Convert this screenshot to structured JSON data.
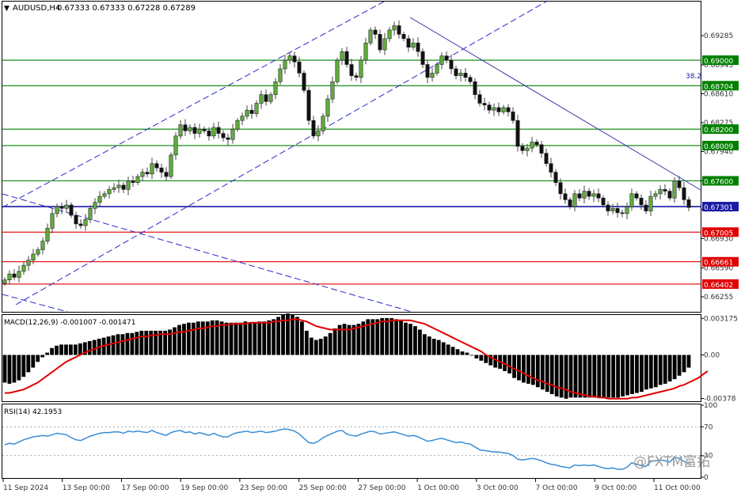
{
  "header": {
    "symbol_label": "AUDUSD,H4",
    "ohlc_label": "0.67333 0.67333 0.67228 0.67289"
  },
  "watermark": {
    "text": "@FXTM富拓"
  },
  "fib_label": "38.2",
  "chart_data": [
    {
      "type": "candlestick",
      "symbol": "AUDUSD",
      "timeframe": "H4",
      "last_bar": {
        "open": 0.67333,
        "high": 0.67333,
        "low": 0.67228,
        "close": 0.67289
      },
      "ylim": [
        0.6608,
        0.6968
      ],
      "price_ticks": [
        0.69285,
        0.68945,
        0.6861,
        0.68275,
        0.6794,
        0.676,
        0.6727,
        0.6693,
        0.6659,
        0.66255
      ],
      "price_tick_labels": [
        "0.69285",
        "0.68945",
        "0.68610",
        "0.68275",
        "0.67940",
        "0.67600",
        "0.67270",
        "0.66930",
        "0.66590",
        "0.66255"
      ],
      "x_labels": [
        "11 Sep 2024",
        "13 Sep 00:00",
        "17 Sep 00:00",
        "19 Sep 00:00",
        "23 Sep 00:00",
        "25 Sep 00:00",
        "27 Sep 00:00",
        "1 Oct 00:00",
        "3 Oct 00:00",
        "7 Oct 00:00",
        "9 Oct 00:00",
        "11 Oct 00:00"
      ],
      "horizontal_levels": [
        {
          "value": 0.69,
          "label": "0.69000",
          "color": "#008000"
        },
        {
          "value": 0.68704,
          "label": "0.68704",
          "color": "#008000"
        },
        {
          "value": 0.682,
          "label": "0.68200",
          "color": "#008000"
        },
        {
          "value": 0.68009,
          "label": "0.68009",
          "color": "#008000"
        },
        {
          "value": 0.676,
          "label": "0.67600",
          "color": "#008000"
        },
        {
          "value": 0.67301,
          "label": "0.67301",
          "color": "#1a1aa6"
        },
        {
          "value": 0.67005,
          "label": "0.67005",
          "color": "#e00000"
        },
        {
          "value": 0.66661,
          "label": "0.66661",
          "color": "#e00000"
        },
        {
          "value": 0.66402,
          "label": "0.66402",
          "color": "#e00000"
        }
      ],
      "close_series": [
        0.6645,
        0.6652,
        0.6648,
        0.6655,
        0.6662,
        0.6668,
        0.6675,
        0.668,
        0.669,
        0.6705,
        0.6722,
        0.673,
        0.6728,
        0.6732,
        0.672,
        0.671,
        0.6708,
        0.6715,
        0.6728,
        0.6735,
        0.6742,
        0.6745,
        0.675,
        0.6752,
        0.6755,
        0.675,
        0.676,
        0.6758,
        0.6765,
        0.677,
        0.6768,
        0.678,
        0.6775,
        0.677,
        0.6765,
        0.679,
        0.6812,
        0.6825,
        0.6818,
        0.6822,
        0.6815,
        0.682,
        0.6818,
        0.6812,
        0.6822,
        0.6815,
        0.681,
        0.6808,
        0.682,
        0.683,
        0.6835,
        0.6842,
        0.6838,
        0.685,
        0.686,
        0.6852,
        0.686,
        0.6875,
        0.689,
        0.69,
        0.6905,
        0.6898,
        0.6885,
        0.6865,
        0.683,
        0.6812,
        0.6818,
        0.6835,
        0.6855,
        0.6875,
        0.69,
        0.691,
        0.6895,
        0.6882,
        0.688,
        0.69,
        0.692,
        0.6935,
        0.693,
        0.6912,
        0.6925,
        0.6935,
        0.694,
        0.693,
        0.6925,
        0.6915,
        0.692,
        0.691,
        0.6895,
        0.688,
        0.6885,
        0.6895,
        0.6905,
        0.69,
        0.689,
        0.6882,
        0.6885,
        0.688,
        0.6875,
        0.686,
        0.685,
        0.6848,
        0.6842,
        0.6845,
        0.684,
        0.6845,
        0.684,
        0.683,
        0.68,
        0.6795,
        0.6798,
        0.6805,
        0.6802,
        0.6792,
        0.678,
        0.677,
        0.6758,
        0.6745,
        0.6738,
        0.673,
        0.6745,
        0.674,
        0.6748,
        0.6742,
        0.6745,
        0.674,
        0.6732,
        0.6725,
        0.6728,
        0.6723,
        0.6722,
        0.673,
        0.6745,
        0.674,
        0.6732,
        0.6725,
        0.6742,
        0.6745,
        0.675,
        0.6748,
        0.674,
        0.676,
        0.6752,
        0.6738,
        0.6729
      ]
    },
    {
      "type": "histogram",
      "indicator": "MACD",
      "label": "MACD(12,26,9) -0.001007 -0.001471",
      "params": [
        12,
        26,
        9
      ],
      "macd": -0.001007,
      "signal": -0.001471,
      "ylim": [
        -0.00395,
        0.0034
      ],
      "ticks": [
        0.003175,
        0.0,
        -0.00378
      ],
      "tick_labels": [
        "0.003175",
        "0.00",
        "-0.00378"
      ],
      "histogram": [
        -0.0024,
        -0.0025,
        -0.0024,
        -0.0022,
        -0.0019,
        -0.0015,
        -0.0011,
        -0.0006,
        -0.0002,
        0.0002,
        0.0006,
        0.0008,
        0.0009,
        0.0009,
        0.0009,
        0.0009,
        0.001,
        0.0011,
        0.0012,
        0.0013,
        0.0014,
        0.0015,
        0.0016,
        0.0017,
        0.0018,
        0.0018,
        0.0019,
        0.0019,
        0.002,
        0.0021,
        0.0021,
        0.0021,
        0.0021,
        0.0021,
        0.0021,
        0.0022,
        0.0024,
        0.0026,
        0.0027,
        0.0028,
        0.0028,
        0.0029,
        0.0029,
        0.0029,
        0.003,
        0.003,
        0.0029,
        0.0028,
        0.0028,
        0.0028,
        0.0028,
        0.0029,
        0.0028,
        0.0028,
        0.0029,
        0.0029,
        0.003,
        0.0031,
        0.0033,
        0.0035,
        0.0036,
        0.0035,
        0.0033,
        0.0029,
        0.0021,
        0.0015,
        0.0013,
        0.0014,
        0.0016,
        0.0019,
        0.0023,
        0.0026,
        0.0027,
        0.0026,
        0.0026,
        0.0027,
        0.0029,
        0.0031,
        0.0031,
        0.0031,
        0.0032,
        0.0032,
        0.0032,
        0.0031,
        0.003,
        0.0028,
        0.0027,
        0.0025,
        0.0022,
        0.0018,
        0.0016,
        0.0014,
        0.0013,
        0.0011,
        0.0009,
        0.0007,
        0.0005,
        0.0003,
        0.0002,
        0.0,
        -0.0003,
        -0.0005,
        -0.0007,
        -0.0009,
        -0.0011,
        -0.0012,
        -0.0014,
        -0.0016,
        -0.002,
        -0.0022,
        -0.0024,
        -0.0025,
        -0.0026,
        -0.0028,
        -0.003,
        -0.0032,
        -0.0034,
        -0.0036,
        -0.0037,
        -0.0038,
        -0.0037,
        -0.0037,
        -0.0037,
        -0.0037,
        -0.0037,
        -0.0037,
        -0.0037,
        -0.0037,
        -0.0037,
        -0.0037,
        -0.0037,
        -0.0036,
        -0.0035,
        -0.0034,
        -0.0033,
        -0.0032,
        -0.003,
        -0.0029,
        -0.0028,
        -0.0026,
        -0.0025,
        -0.0023,
        -0.0021,
        -0.0018,
        -0.0015,
        -0.0011
      ],
      "signal_line": [
        -0.0033,
        -0.0033,
        -0.0032,
        -0.0031,
        -0.003,
        -0.0028,
        -0.0026,
        -0.0024,
        -0.0021,
        -0.0018,
        -0.0015,
        -0.0012,
        -0.0009,
        -0.0006,
        -0.0004,
        -0.0002,
        0.0,
        0.0002,
        0.0004,
        0.0005,
        0.0007,
        0.0008,
        0.0009,
        0.001,
        0.0011,
        0.0012,
        0.0013,
        0.0014,
        0.0015,
        0.0016,
        0.0016,
        0.0017,
        0.0017,
        0.0018,
        0.0018,
        0.0018,
        0.0019,
        0.002,
        0.002,
        0.0021,
        0.0022,
        0.0023,
        0.0023,
        0.0024,
        0.0025,
        0.0025,
        0.0026,
        0.0026,
        0.0027,
        0.0027,
        0.0027,
        0.0027,
        0.0028,
        0.0028,
        0.0028,
        0.0028,
        0.0028,
        0.0029,
        0.0029,
        0.003,
        0.003,
        0.0031,
        0.0031,
        0.003,
        0.0029,
        0.0027,
        0.0025,
        0.0024,
        0.0023,
        0.0022,
        0.0022,
        0.0022,
        0.0022,
        0.0022,
        0.0023,
        0.0024,
        0.0025,
        0.0026,
        0.0027,
        0.0028,
        0.0029,
        0.0029,
        0.003,
        0.003,
        0.003,
        0.003,
        0.003,
        0.0029,
        0.0028,
        0.0027,
        0.0025,
        0.0023,
        0.0021,
        0.0019,
        0.0017,
        0.0015,
        0.0013,
        0.0011,
        0.0009,
        0.0007,
        0.0005,
        0.0003,
        0.0,
        -0.0002,
        -0.0004,
        -0.0006,
        -0.0008,
        -0.001,
        -0.0012,
        -0.0014,
        -0.0016,
        -0.0018,
        -0.002,
        -0.0022,
        -0.0023,
        -0.0025,
        -0.0026,
        -0.0028,
        -0.0029,
        -0.003,
        -0.0032,
        -0.0033,
        -0.0034,
        -0.0035,
        -0.0036,
        -0.0036,
        -0.0037,
        -0.0037,
        -0.0038,
        -0.0038,
        -0.0038,
        -0.0038,
        -0.0038,
        -0.0037,
        -0.0037,
        -0.0036,
        -0.0035,
        -0.0034,
        -0.0033,
        -0.0032,
        -0.0031,
        -0.003,
        -0.0029,
        -0.0027,
        -0.0026,
        -0.0024,
        -0.0022,
        -0.002,
        -0.0017,
        -0.0014
      ]
    },
    {
      "type": "line",
      "indicator": "RSI",
      "label": "RSI(14) 42.1953",
      "period": 14,
      "value": 42.1953,
      "ylim": [
        0,
        100
      ],
      "ticks": [
        100,
        70,
        30,
        0
      ],
      "tick_labels": [
        "100",
        "70",
        "30",
        "0"
      ],
      "values": [
        45,
        47,
        46,
        49,
        52,
        54,
        56,
        57,
        58,
        57,
        59,
        61,
        60,
        59,
        55,
        52,
        51,
        54,
        57,
        59,
        61,
        62,
        62,
        63,
        63,
        61,
        64,
        63,
        64,
        63,
        62,
        65,
        62,
        60,
        58,
        62,
        64,
        65,
        62,
        63,
        60,
        62,
        60,
        58,
        61,
        58,
        56,
        56,
        60,
        62,
        63,
        64,
        62,
        63,
        64,
        62,
        63,
        64,
        66,
        67,
        66,
        64,
        60,
        54,
        48,
        47,
        50,
        55,
        58,
        61,
        64,
        65,
        60,
        58,
        57,
        60,
        62,
        64,
        63,
        60,
        61,
        62,
        63,
        61,
        59,
        57,
        58,
        56,
        53,
        50,
        51,
        53,
        54,
        52,
        50,
        48,
        49,
        47,
        46,
        42,
        38,
        37,
        36,
        35,
        35,
        34,
        33,
        30,
        25,
        24,
        25,
        26,
        25,
        23,
        20,
        18,
        17,
        15,
        14,
        13,
        17,
        16,
        17,
        16,
        17,
        15,
        13,
        12,
        13,
        11,
        11,
        14,
        20,
        18,
        16,
        15,
        22,
        23,
        24,
        23,
        21,
        28,
        26,
        22,
        19
      ]
    }
  ],
  "colors": {
    "candle_bull": "#5fae3c",
    "candle_bear": "#111111",
    "wick": "#444444",
    "channel_line": "#2a2acb",
    "macd_bar": "#000000",
    "macd_signal": "#e00000",
    "rsi_line": "#3a8ed6",
    "level_green": "#008000",
    "level_blue": "#1a1aa6",
    "level_red": "#e00000",
    "axis_text": "#333333"
  }
}
